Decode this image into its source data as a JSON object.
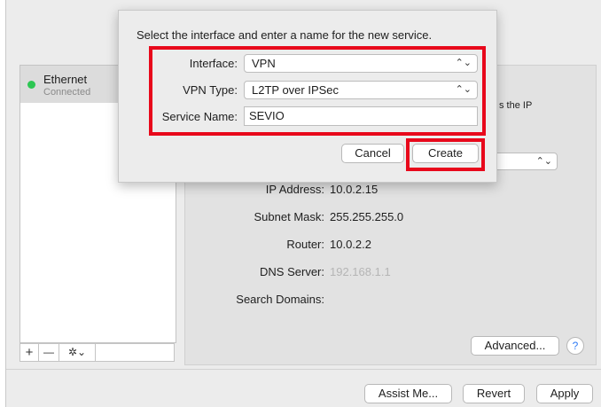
{
  "services": [
    {
      "name": "Ethernet",
      "status": "Connected",
      "status_color": "#2dc653"
    }
  ],
  "list_tools": {
    "add": "+",
    "remove": "—",
    "gear": "✲⌄"
  },
  "detail": {
    "partial_text": "s the IP",
    "rows": [
      {
        "label": "IP Address:",
        "value": "10.0.2.15"
      },
      {
        "label": "Subnet Mask:",
        "value": "255.255.255.0"
      },
      {
        "label": "Router:",
        "value": "10.0.2.2"
      },
      {
        "label": "DNS Server:",
        "value": "192.168.1.1"
      },
      {
        "label": "Search Domains:",
        "value": ""
      }
    ],
    "advanced_label": "Advanced...",
    "help_label": "?"
  },
  "bottom": {
    "assist_label": "Assist Me...",
    "revert_label": "Revert",
    "apply_label": "Apply"
  },
  "dialog": {
    "title": "Select the interface and enter a name for the new service.",
    "interface_label": "Interface:",
    "interface_value": "VPN",
    "vpn_type_label": "VPN Type:",
    "vpn_type_value": "L2TP over IPSec",
    "service_name_label": "Service Name:",
    "service_name_value": "SEVIO",
    "cancel_label": "Cancel",
    "create_label": "Create"
  },
  "icons": {
    "popup_chevron": "updown-chevron-icon",
    "gear": "gear-icon",
    "help": "help-icon"
  },
  "colors": {
    "highlight": "#e8081b",
    "status_green": "#2dc653",
    "help_blue": "#2f7cf6"
  }
}
